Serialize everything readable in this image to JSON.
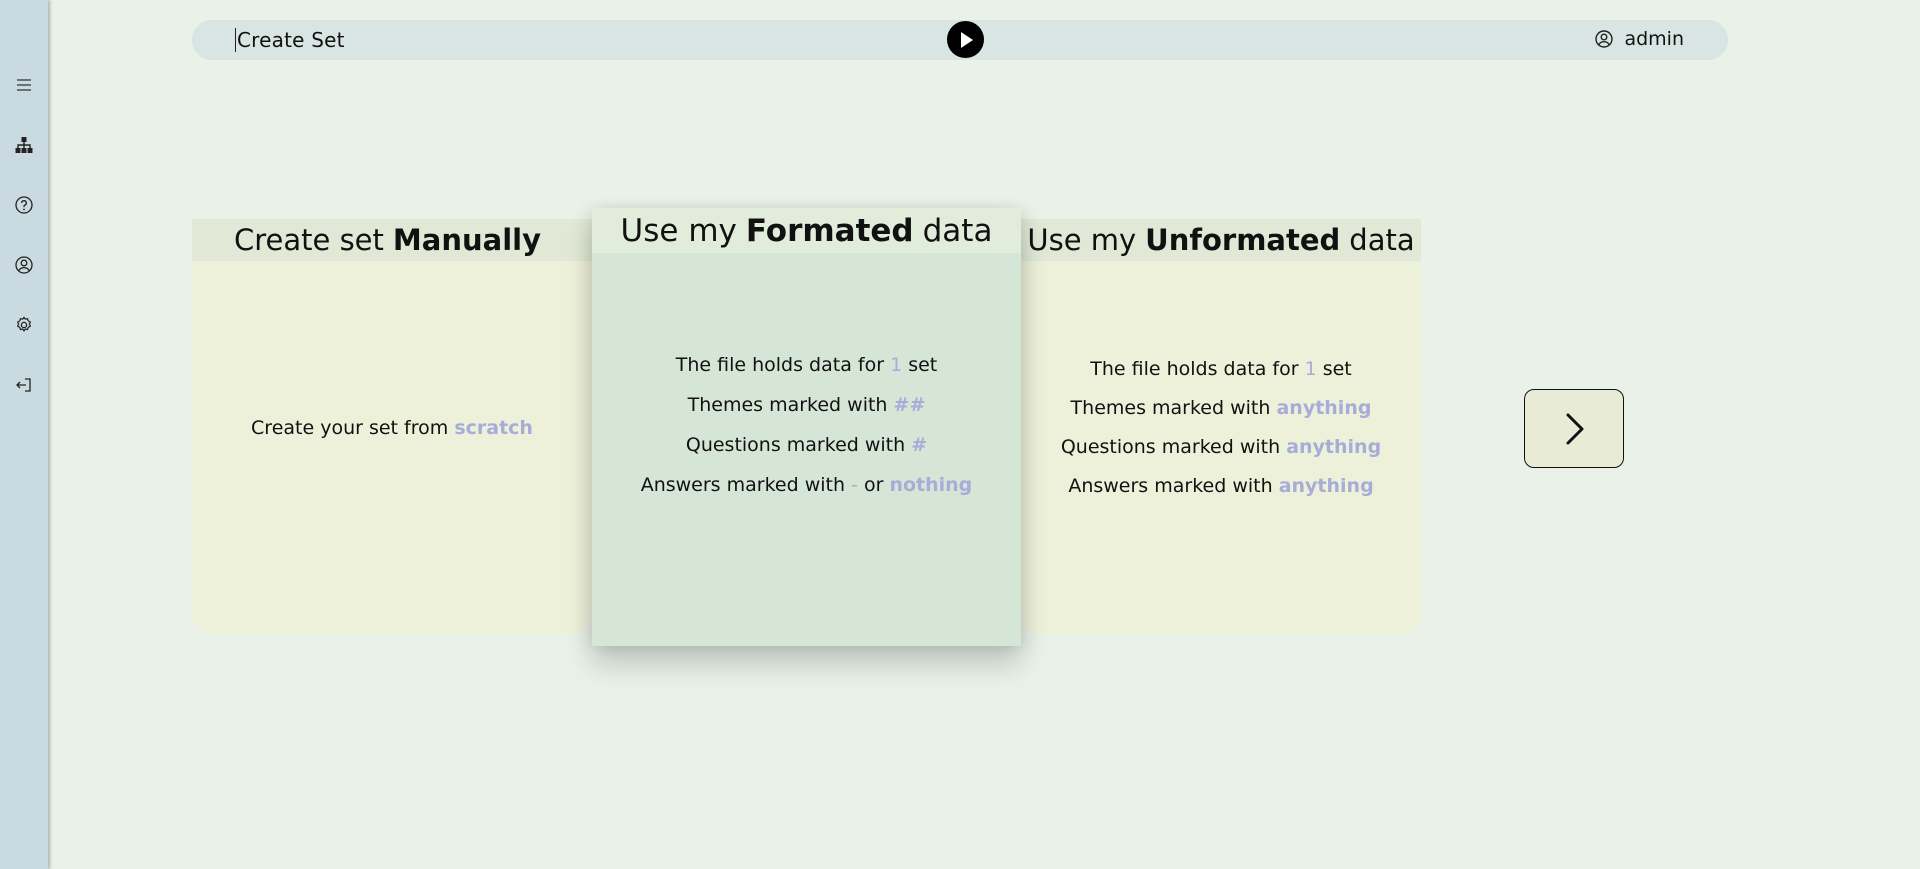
{
  "header": {
    "title": "Create Set",
    "user_name": "admin"
  },
  "sidebar": {
    "items": [
      {
        "icon": "menu-icon"
      },
      {
        "icon": "sitemap-icon"
      },
      {
        "icon": "help-icon"
      },
      {
        "icon": "user-circle-icon"
      },
      {
        "icon": "gear-icon"
      },
      {
        "icon": "logout-icon"
      }
    ]
  },
  "cards": {
    "manual": {
      "title_prefix": "Create set",
      "title_bold": "Manually",
      "title_suffix": "",
      "line1_text": "Create your set from",
      "line1_hl": "scratch"
    },
    "formatted": {
      "title_prefix": "Use my",
      "title_bold": "Formated",
      "title_suffix": "data",
      "l1_text": "The file holds data for",
      "l1_hl": "1",
      "l1_tail": "set",
      "l2_text": "Themes marked with",
      "l2_hl": "##",
      "l3_text": "Questions marked with",
      "l3_hl": "#",
      "l4_text": "Answers marked with",
      "l4_hl": "-",
      "l4_mid": "or",
      "l4_hl2": "nothing"
    },
    "unformatted": {
      "title_prefix": "Use my",
      "title_bold": "Unformated",
      "title_suffix": "data",
      "l1_text": "The file holds data for",
      "l1_hl": "1",
      "l1_tail": "set",
      "l2_text": "Themes marked with",
      "l2_hl": "anything",
      "l3_text": "Questions marked with",
      "l3_hl": "anything",
      "l4_text": "Answers marked with",
      "l4_hl": "anything"
    }
  },
  "colors": {
    "highlight": "#a7acd8",
    "background": "#e9f1e8",
    "sidebar": "#c9dbe0"
  }
}
